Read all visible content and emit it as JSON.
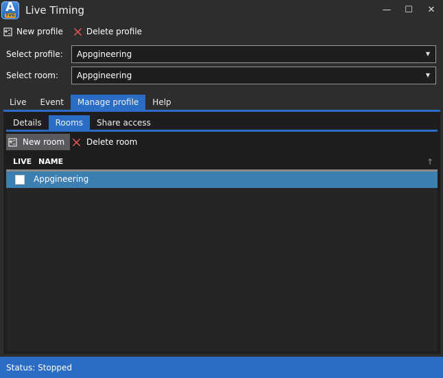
{
  "window": {
    "title": "Live Timing",
    "app_icon_letter": "A",
    "app_icon_badge": "TVG",
    "controls": {
      "minimize": "—",
      "maximize": "☐",
      "close": "✕"
    }
  },
  "toolbar": {
    "new_profile": "New profile",
    "delete_profile": "Delete profile"
  },
  "profile": {
    "label": "Select profile:",
    "value": "Appgineering"
  },
  "room": {
    "label": "Select room:",
    "value": "Appgineering"
  },
  "main_tabs": [
    {
      "label": "Live"
    },
    {
      "label": "Event"
    },
    {
      "label": "Manage profile",
      "active": true
    },
    {
      "label": "Help"
    }
  ],
  "sub_tabs": [
    {
      "label": "Details"
    },
    {
      "label": "Rooms",
      "active": true
    },
    {
      "label": "Share access"
    }
  ],
  "room_toolbar": {
    "new_room": "New room",
    "delete_room": "Delete room"
  },
  "grid": {
    "columns": {
      "live": "LIVE",
      "name": "NAME"
    },
    "rows": [
      {
        "live": false,
        "name": "Appgineering"
      }
    ]
  },
  "status": {
    "text": "Status: Stopped"
  },
  "colors": {
    "accent": "#2b6cc4",
    "selected_row": "#3c7fb0",
    "delete_icon": "#d9534f",
    "background": "#2d2d30",
    "panel": "#1e1e1e"
  },
  "icons": {
    "new_profile": "add-document-icon",
    "delete_profile": "x-icon",
    "new_room": "add-document-icon",
    "delete_room": "x-icon",
    "combo_arrow": "triangle-down-icon",
    "sort": "arrow-up-icon"
  }
}
